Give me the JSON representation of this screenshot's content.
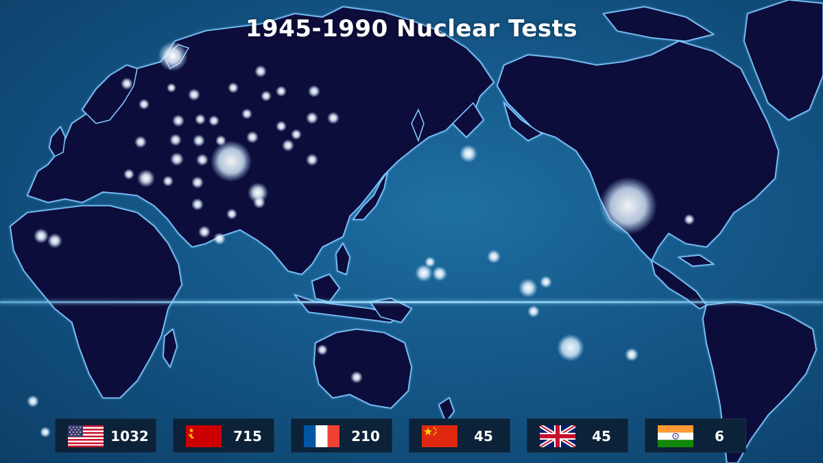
{
  "title": "1945-1990 Nuclear Tests",
  "colors": {
    "ocean": "#15598a",
    "land": "#080e3a",
    "coast": "#7fc6ff",
    "glow": "#e8f4ff",
    "equator": "#9fd8ff",
    "card": "#0c2238"
  },
  "tests": [
    {
      "country": "United States",
      "flag_icon": "us-flag-icon",
      "count": "1032"
    },
    {
      "country": "Soviet Union",
      "flag_icon": "ussr-flag-icon",
      "count": "715"
    },
    {
      "country": "France",
      "flag_icon": "france-flag-icon",
      "count": "210"
    },
    {
      "country": "China",
      "flag_icon": "china-flag-icon",
      "count": "45"
    },
    {
      "country": "United Kingdom",
      "flag_icon": "uk-flag-icon",
      "count": "45"
    },
    {
      "country": "India",
      "flag_icon": "india-flag-icon",
      "count": "6"
    }
  ]
}
